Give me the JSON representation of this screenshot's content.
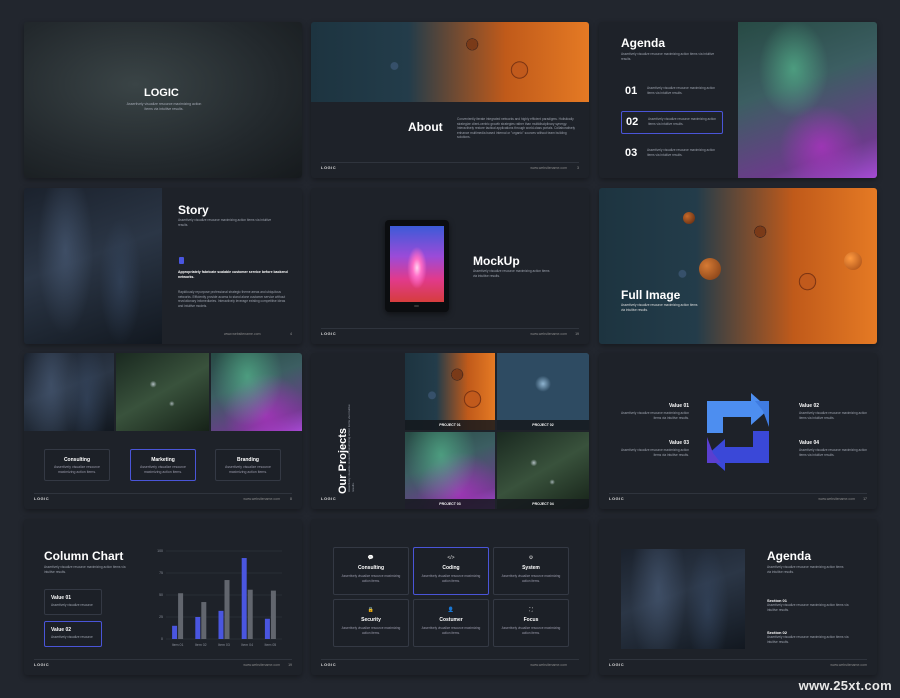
{
  "common": {
    "logo": "LOGIC",
    "url": "www.websitename.com",
    "desc": "Assertively visualize resource maximizing action items via intuitive results."
  },
  "s1": {
    "title": "LOGIC",
    "sub": "Assertively visualize resource maximizing action items via intuitive results."
  },
  "s2": {
    "title": "About",
    "body": "Conveniently iterate integrated networks and highly efficient paradigms. Holistically strategize client-centric growth strategies rather than multidisciplinary synergy. Interactively restore tactical applications through world-class portals. Collaboratively enhance multimedia based internal or \"organic\" sources without team building solutions.",
    "page": "3"
  },
  "s3": {
    "title": "Agenda",
    "sub": "Assertively visualize resource maximizing action items via intuitive results.",
    "items": [
      {
        "num": "01",
        "text": "Assertively visualize resource maximizing action items via intuitive results."
      },
      {
        "num": "02",
        "text": "Assertively visualize resource maximizing action items via intuitive results."
      },
      {
        "num": "03",
        "text": "Assertively visualize resource maximizing action items via intuitive results."
      }
    ]
  },
  "s4": {
    "title": "Story",
    "sub": "Assertively visualize resource maximizing action items via intuitive results.",
    "bold": "Appropriately fabricate scalable customer service before backend networks.",
    "body": "Rapidiously repurpose professional strategic theme areas and ubiquitous networks. Efficiently provide access to stand alone customer service without revolutionary infomediaries. Interactively leverage existing competitive ideas and intuitive models.",
    "page": "4"
  },
  "s5": {
    "title": "MockUp",
    "sub": "Assertively visualize resource maximizing action items via intuitive results.",
    "page": "19"
  },
  "s6": {
    "title": "Full Image",
    "sub": "Assertively visualize resource maximizing action items via intuitive results."
  },
  "s7": {
    "labels": [
      "Consulting",
      "Marketing",
      "Branding"
    ],
    "desc": "Assertively visualize resource maximizing action items.",
    "page": "8"
  },
  "s8": {
    "title": "Our Projects",
    "sub": "Assertively visualize resource maximizing action items via intuitive results.",
    "projects": [
      "PROJECT 01",
      "PROJECT 02",
      "PROJECT 03",
      "PROJECT 04"
    ]
  },
  "s9": {
    "values": [
      {
        "t": "Value 01",
        "d": "Assertively visualize resource maximizing action items via intuitive results."
      },
      {
        "t": "Value 02",
        "d": "Assertively visualize resource maximizing action items via intuitive results."
      },
      {
        "t": "Value 03",
        "d": "Assertively visualize resource maximizing action items via intuitive results."
      },
      {
        "t": "Value 04",
        "d": "Assertively visualize resource maximizing action items via intuitive results."
      }
    ],
    "page": "17",
    "accent": "#3a48d8"
  },
  "s10": {
    "title": "Column Chart",
    "sub": "Assertively visualize resource maximizing action items via intuitive results.",
    "v1": "Value 01",
    "v2": "Value 02",
    "vd": "Assertively visualize resource",
    "page": "19"
  },
  "chart_data": {
    "type": "bar",
    "categories": [
      "Item 01",
      "Item 02",
      "Item 03",
      "Item 04",
      "Item 05"
    ],
    "series": [
      {
        "name": "",
        "values": [
          15,
          25,
          32,
          92,
          23
        ],
        "color": "#4a56e0"
      },
      {
        "name": "",
        "values": [
          52,
          42,
          67,
          56,
          55
        ],
        "color": "#62666e"
      }
    ],
    "yticks": [
      "0",
      "25",
      "50",
      "75",
      "100"
    ],
    "ylim": [
      0,
      100
    ]
  },
  "s11": {
    "items": [
      {
        "icon": "💬",
        "t": "Consulting"
      },
      {
        "icon": "</>",
        "t": "Coding"
      },
      {
        "icon": "⚙",
        "t": "System"
      },
      {
        "icon": "🔒",
        "t": "Security"
      },
      {
        "icon": "👤",
        "t": "Costumer"
      },
      {
        "icon": "⛶",
        "t": "Focus"
      }
    ],
    "desc": "Assertively visualize resource maximizing action items."
  },
  "s12": {
    "title": "Agenda",
    "sub": "Assertively visualize resource maximizing action items via intuitive results.",
    "sec1": "Section 01",
    "sec2": "Section 02",
    "secd": "Assertively visualize resource maximizing action items via intuitive results."
  },
  "watermark": "www.25xt.com"
}
